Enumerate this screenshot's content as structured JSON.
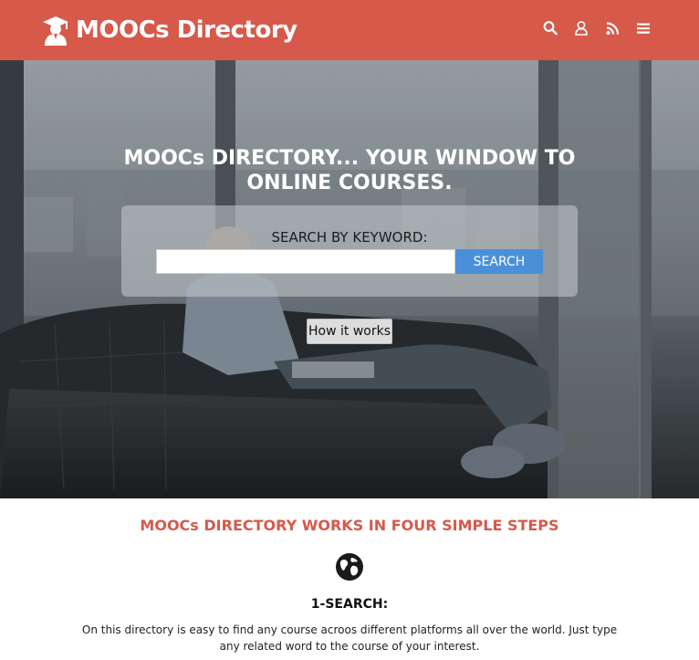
{
  "header": {
    "brand_name": "MOOCs Directory",
    "brand_icon": "graduate-icon",
    "nav_icons": [
      "search-icon",
      "user-icon",
      "rss-icon",
      "menu-icon"
    ],
    "background_color": "#d6594a"
  },
  "hero": {
    "title_line1": "MOOCs DIRECTORY... YOUR WINDOW TO",
    "title_line2": "ONLINE COURSES.",
    "search_label": "SEARCH BY KEYWORD:",
    "search_input_value": "",
    "search_button_label": "SEARCH",
    "how_it_works_label": "How it works"
  },
  "steps": {
    "title": "MOOCs DIRECTORY WORKS IN FOUR SIMPLE STEPS",
    "items": [
      {
        "icon": "globe-icon",
        "heading": "1-SEARCH:",
        "text": "On this directory is easy to find any course acroos different platforms all over the world. Just type any related word to the course of your interest."
      }
    ]
  },
  "colors": {
    "accent": "#d6594a",
    "search_button": "#4a90d9"
  }
}
